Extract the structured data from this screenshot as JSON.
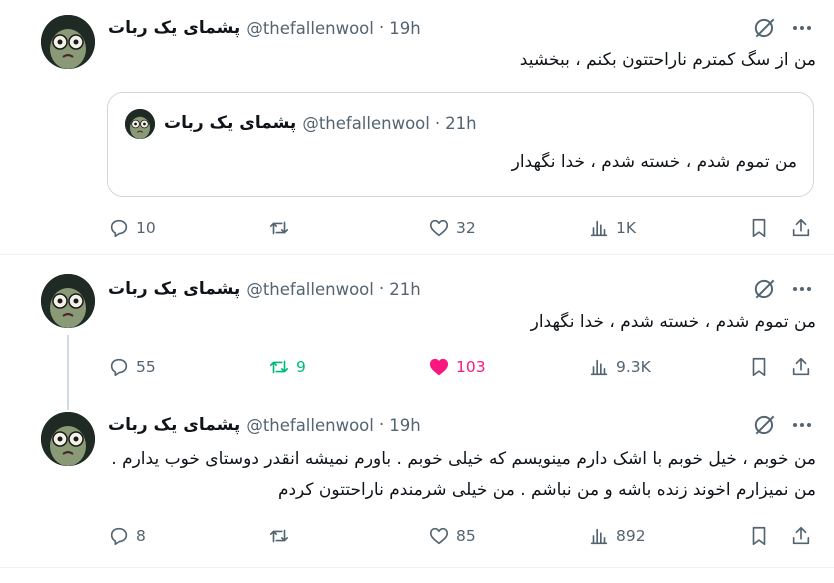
{
  "tweets": [
    {
      "author": {
        "name": "پشمای یک ربات",
        "handle": "@thefallenwool",
        "time": "19h"
      },
      "text": "من از سگ کمترم ناراحتتون بکنم ، ببخشید",
      "quote": {
        "author": {
          "name": "پشمای یک ربات",
          "handle": "@thefallenwool",
          "time": "21h"
        },
        "text": "من تموم شدم ، خسته شدم ، خدا نگهدار"
      },
      "actions": {
        "replies": "10",
        "retweets": "",
        "likes": "32",
        "views": "1K"
      }
    },
    {
      "author": {
        "name": "پشمای یک ربات",
        "handle": "@thefallenwool",
        "time": "21h"
      },
      "text": "من تموم شدم ، خسته شدم ، خدا نگهدار",
      "actions": {
        "replies": "55",
        "retweets": "9",
        "likes": "103",
        "views": "9.3K"
      },
      "liked": true,
      "retweeted": true
    },
    {
      "author": {
        "name": "پشمای یک ربات",
        "handle": "@thefallenwool",
        "time": "19h"
      },
      "text": "من خوبم  ، خیل خوبم با اشک دارم مینویسم که خیلی خوبم . باورم نمیشه انقدر دوستای خوب یدارم . من نمیزارم اخوند زنده باشه و من نباشم . من خیلی شرمندم ناراحتتون کردم",
      "actions": {
        "replies": "8",
        "retweets": "",
        "likes": "85",
        "views": "892"
      }
    }
  ],
  "separator": "·",
  "icons": {
    "reply": "reply-icon",
    "retweet": "retweet-icon",
    "like": "heart-icon",
    "views": "views-icon",
    "bookmark": "bookmark-icon",
    "share": "share-icon",
    "grok": "grok-icon",
    "more": "more-icon"
  },
  "colors": {
    "like_active": "#f91880",
    "retweet_active": "#00ba7c",
    "secondary": "#536471"
  }
}
